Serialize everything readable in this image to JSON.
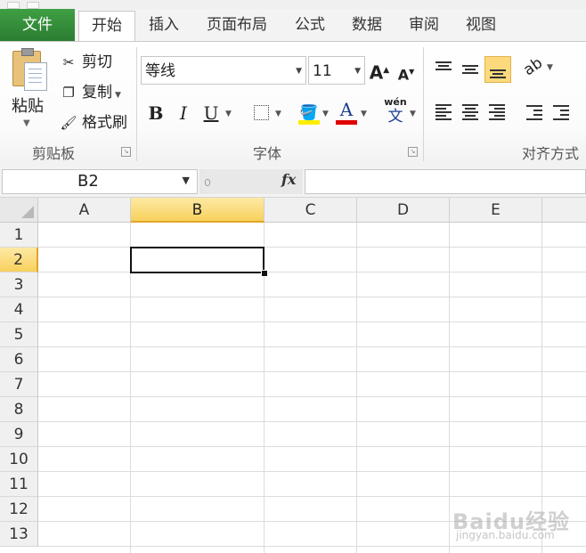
{
  "ribbon_tabs": [
    "文件",
    "开始",
    "插入",
    "页面布局",
    "公式",
    "数据",
    "审阅",
    "视图"
  ],
  "clipboard": {
    "paste": "粘贴",
    "cut": "剪切",
    "copy": "复制",
    "format_painter": "格式刷",
    "group_label": "剪贴板"
  },
  "font": {
    "name": "等线",
    "size": "11",
    "grow": "A",
    "shrink": "A",
    "bold": "B",
    "italic": "I",
    "underline": "U",
    "font_color_letter": "A",
    "phonetic": "wén",
    "phonetic_char": "文",
    "group_label": "字体",
    "colors": {
      "highlight": "#ffee00",
      "font_color": "#e00000"
    }
  },
  "alignment": {
    "group_label": "对齐方式"
  },
  "formula_bar": {
    "name_box": "B2",
    "fx": "fx",
    "formula": ""
  },
  "sheet": {
    "columns": [
      "A",
      "B",
      "C",
      "D",
      "E"
    ],
    "rows": [
      "1",
      "2",
      "3",
      "4",
      "5",
      "6",
      "7",
      "8",
      "9",
      "10",
      "11",
      "12",
      "13"
    ],
    "selected_column": "B",
    "selected_row": "2",
    "active_cell": "B2",
    "accent": "#f8d15c"
  },
  "watermark": {
    "brand": "Baidu经验",
    "url": "jingyan.baidu.com"
  }
}
